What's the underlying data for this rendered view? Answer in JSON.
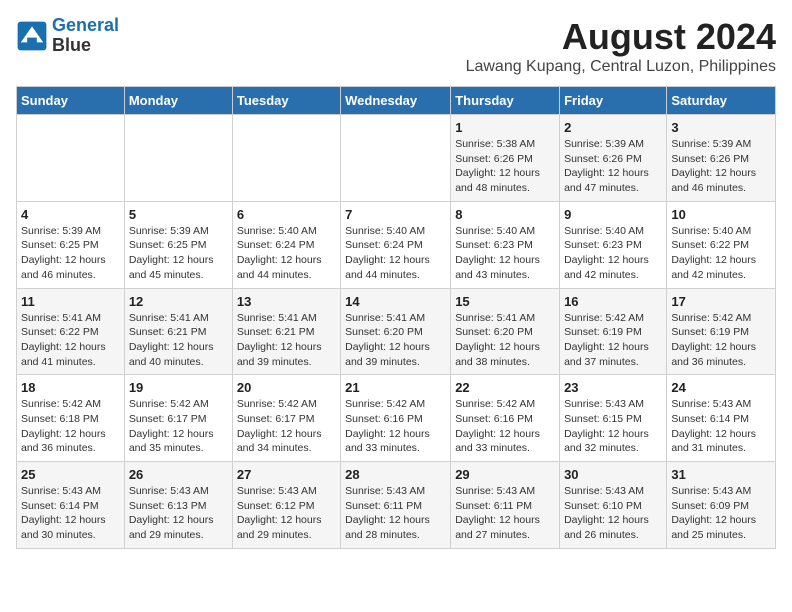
{
  "logo": {
    "line1": "General",
    "line2": "Blue"
  },
  "title": "August 2024",
  "subtitle": "Lawang Kupang, Central Luzon, Philippines",
  "days_of_week": [
    "Sunday",
    "Monday",
    "Tuesday",
    "Wednesday",
    "Thursday",
    "Friday",
    "Saturday"
  ],
  "weeks": [
    [
      {
        "day": "",
        "info": ""
      },
      {
        "day": "",
        "info": ""
      },
      {
        "day": "",
        "info": ""
      },
      {
        "day": "",
        "info": ""
      },
      {
        "day": "1",
        "info": "Sunrise: 5:38 AM\nSunset: 6:26 PM\nDaylight: 12 hours\nand 48 minutes."
      },
      {
        "day": "2",
        "info": "Sunrise: 5:39 AM\nSunset: 6:26 PM\nDaylight: 12 hours\nand 47 minutes."
      },
      {
        "day": "3",
        "info": "Sunrise: 5:39 AM\nSunset: 6:26 PM\nDaylight: 12 hours\nand 46 minutes."
      }
    ],
    [
      {
        "day": "4",
        "info": "Sunrise: 5:39 AM\nSunset: 6:25 PM\nDaylight: 12 hours\nand 46 minutes."
      },
      {
        "day": "5",
        "info": "Sunrise: 5:39 AM\nSunset: 6:25 PM\nDaylight: 12 hours\nand 45 minutes."
      },
      {
        "day": "6",
        "info": "Sunrise: 5:40 AM\nSunset: 6:24 PM\nDaylight: 12 hours\nand 44 minutes."
      },
      {
        "day": "7",
        "info": "Sunrise: 5:40 AM\nSunset: 6:24 PM\nDaylight: 12 hours\nand 44 minutes."
      },
      {
        "day": "8",
        "info": "Sunrise: 5:40 AM\nSunset: 6:23 PM\nDaylight: 12 hours\nand 43 minutes."
      },
      {
        "day": "9",
        "info": "Sunrise: 5:40 AM\nSunset: 6:23 PM\nDaylight: 12 hours\nand 42 minutes."
      },
      {
        "day": "10",
        "info": "Sunrise: 5:40 AM\nSunset: 6:22 PM\nDaylight: 12 hours\nand 42 minutes."
      }
    ],
    [
      {
        "day": "11",
        "info": "Sunrise: 5:41 AM\nSunset: 6:22 PM\nDaylight: 12 hours\nand 41 minutes."
      },
      {
        "day": "12",
        "info": "Sunrise: 5:41 AM\nSunset: 6:21 PM\nDaylight: 12 hours\nand 40 minutes."
      },
      {
        "day": "13",
        "info": "Sunrise: 5:41 AM\nSunset: 6:21 PM\nDaylight: 12 hours\nand 39 minutes."
      },
      {
        "day": "14",
        "info": "Sunrise: 5:41 AM\nSunset: 6:20 PM\nDaylight: 12 hours\nand 39 minutes."
      },
      {
        "day": "15",
        "info": "Sunrise: 5:41 AM\nSunset: 6:20 PM\nDaylight: 12 hours\nand 38 minutes."
      },
      {
        "day": "16",
        "info": "Sunrise: 5:42 AM\nSunset: 6:19 PM\nDaylight: 12 hours\nand 37 minutes."
      },
      {
        "day": "17",
        "info": "Sunrise: 5:42 AM\nSunset: 6:19 PM\nDaylight: 12 hours\nand 36 minutes."
      }
    ],
    [
      {
        "day": "18",
        "info": "Sunrise: 5:42 AM\nSunset: 6:18 PM\nDaylight: 12 hours\nand 36 minutes."
      },
      {
        "day": "19",
        "info": "Sunrise: 5:42 AM\nSunset: 6:17 PM\nDaylight: 12 hours\nand 35 minutes."
      },
      {
        "day": "20",
        "info": "Sunrise: 5:42 AM\nSunset: 6:17 PM\nDaylight: 12 hours\nand 34 minutes."
      },
      {
        "day": "21",
        "info": "Sunrise: 5:42 AM\nSunset: 6:16 PM\nDaylight: 12 hours\nand 33 minutes."
      },
      {
        "day": "22",
        "info": "Sunrise: 5:42 AM\nSunset: 6:16 PM\nDaylight: 12 hours\nand 33 minutes."
      },
      {
        "day": "23",
        "info": "Sunrise: 5:43 AM\nSunset: 6:15 PM\nDaylight: 12 hours\nand 32 minutes."
      },
      {
        "day": "24",
        "info": "Sunrise: 5:43 AM\nSunset: 6:14 PM\nDaylight: 12 hours\nand 31 minutes."
      }
    ],
    [
      {
        "day": "25",
        "info": "Sunrise: 5:43 AM\nSunset: 6:14 PM\nDaylight: 12 hours\nand 30 minutes."
      },
      {
        "day": "26",
        "info": "Sunrise: 5:43 AM\nSunset: 6:13 PM\nDaylight: 12 hours\nand 29 minutes."
      },
      {
        "day": "27",
        "info": "Sunrise: 5:43 AM\nSunset: 6:12 PM\nDaylight: 12 hours\nand 29 minutes."
      },
      {
        "day": "28",
        "info": "Sunrise: 5:43 AM\nSunset: 6:11 PM\nDaylight: 12 hours\nand 28 minutes."
      },
      {
        "day": "29",
        "info": "Sunrise: 5:43 AM\nSunset: 6:11 PM\nDaylight: 12 hours\nand 27 minutes."
      },
      {
        "day": "30",
        "info": "Sunrise: 5:43 AM\nSunset: 6:10 PM\nDaylight: 12 hours\nand 26 minutes."
      },
      {
        "day": "31",
        "info": "Sunrise: 5:43 AM\nSunset: 6:09 PM\nDaylight: 12 hours\nand 25 minutes."
      }
    ]
  ]
}
